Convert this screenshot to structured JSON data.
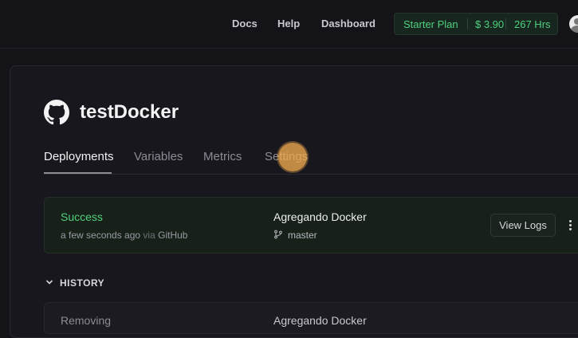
{
  "nav": {
    "docs": "Docs",
    "help": "Help",
    "dashboard": "Dashboard"
  },
  "plan": {
    "name": "Starter Plan",
    "credit": "$ 3.90",
    "hours": "267 Hrs"
  },
  "project": {
    "title": "testDocker",
    "icon": "github-icon"
  },
  "tabs": [
    {
      "label": "Deployments",
      "active": true
    },
    {
      "label": "Variables",
      "active": false
    },
    {
      "label": "Metrics",
      "active": false
    },
    {
      "label": "Settings",
      "active": false
    }
  ],
  "deployment": {
    "status": "Success",
    "time": "a few seconds ago",
    "via_label": "via",
    "source": "GitHub",
    "commit": "Agregando Docker",
    "branch": "master",
    "view_logs": "View Logs"
  },
  "history": {
    "label": "HISTORY",
    "items": [
      {
        "status": "Removing",
        "commit": "Agregando Docker"
      }
    ]
  },
  "colors": {
    "success": "#4ed17e",
    "background": "#141318",
    "panel": "#18171d"
  }
}
